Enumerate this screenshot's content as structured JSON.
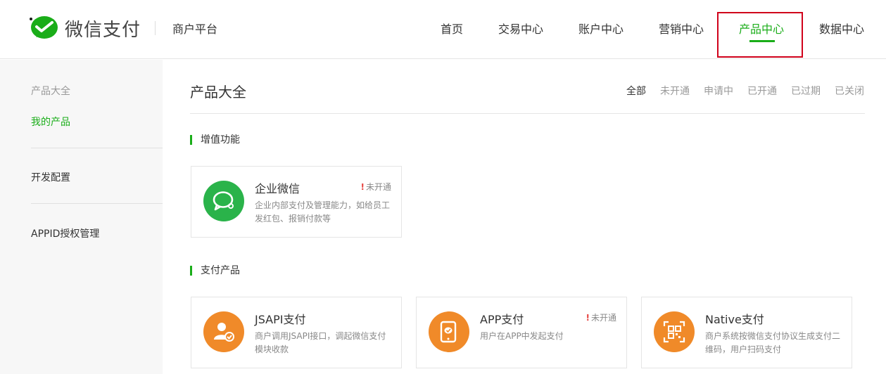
{
  "header": {
    "brand": "微信支付",
    "merchant": "商户平台",
    "nav": [
      {
        "label": "首页"
      },
      {
        "label": "交易中心"
      },
      {
        "label": "账户中心"
      },
      {
        "label": "营销中心"
      },
      {
        "label": "产品中心"
      },
      {
        "label": "数据中心"
      }
    ],
    "active_nav": "产品中心",
    "icons": {
      "logo": "wechat-pay-logo-icon"
    }
  },
  "sidebar": {
    "group_title": "产品大全",
    "items": [
      {
        "label": "我的产品"
      },
      {
        "label": "开发配置"
      },
      {
        "label": "APPID授权管理"
      }
    ]
  },
  "main": {
    "title": "产品大全",
    "filters": [
      {
        "label": "全部"
      },
      {
        "label": "未开通"
      },
      {
        "label": "申请中"
      },
      {
        "label": "已开通"
      },
      {
        "label": "已过期"
      },
      {
        "label": "已关闭"
      }
    ],
    "sections": [
      {
        "title": "增值功能",
        "cards": [
          {
            "title": "企业微信",
            "desc": "企业内部支付及管理能力，如给员工发红包、报销付款等",
            "status": "未开通",
            "icon": "chat-bubble-icon"
          }
        ]
      },
      {
        "title": "支付产品",
        "cards": [
          {
            "title": "JSAPI支付",
            "desc": "商户调用JSAPI接口，调起微信支付模块收款",
            "status": "",
            "icon": "user-check-icon"
          },
          {
            "title": "APP支付",
            "desc": "用户在APP中发起支付",
            "status": "未开通",
            "icon": "mobile-pay-icon"
          },
          {
            "title": "Native支付",
            "desc": "商户系统按微信支付协议生成支付二维码，用户扫码支付",
            "status": "",
            "icon": "qr-code-icon"
          }
        ]
      }
    ]
  },
  "colors": {
    "accent": "#1aad19",
    "highlight_box": "#d0021b",
    "orange": "#f08a29",
    "green_icon": "#2ab34a"
  }
}
